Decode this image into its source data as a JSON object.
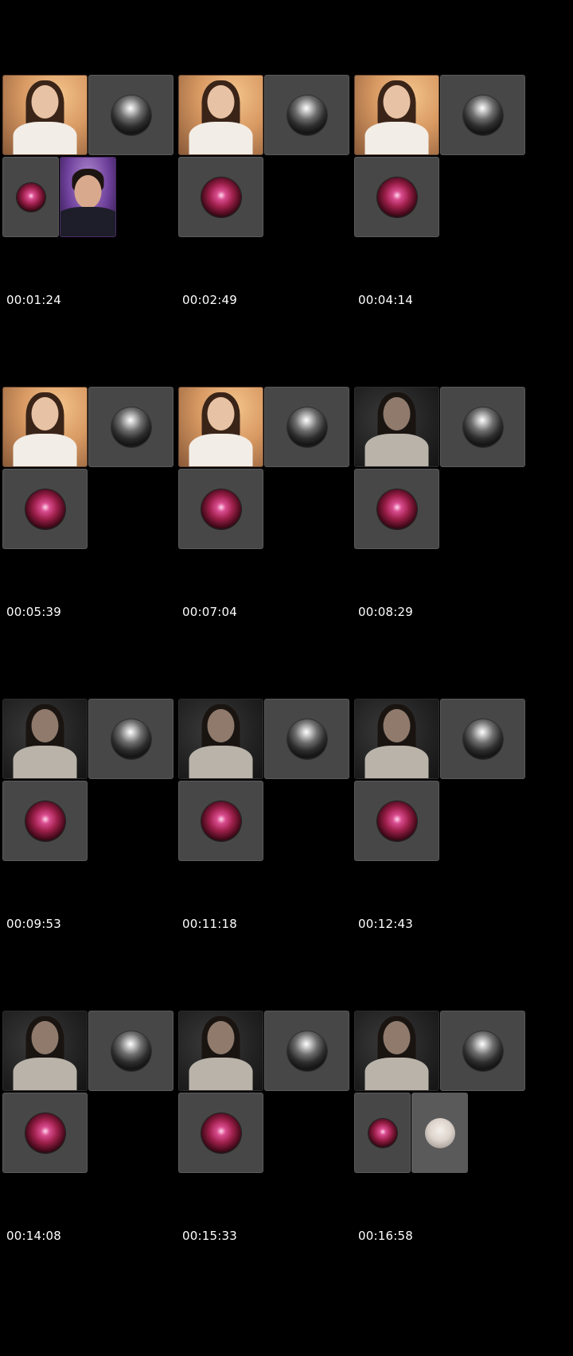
{
  "grid": {
    "frames": [
      {
        "timestamp": "00:01:24",
        "participants": [
          "video-warm",
          "avatar-moon",
          "avatar-stage",
          "video-purple"
        ]
      },
      {
        "timestamp": "00:02:49",
        "participants": [
          "video-warm",
          "avatar-moon",
          "avatar-stage"
        ]
      },
      {
        "timestamp": "00:04:14",
        "participants": [
          "video-warm",
          "avatar-moon",
          "avatar-stage"
        ]
      },
      {
        "timestamp": "00:05:39",
        "participants": [
          "video-warm",
          "avatar-moon",
          "avatar-stage"
        ]
      },
      {
        "timestamp": "00:07:04",
        "participants": [
          "video-warm",
          "avatar-moon",
          "avatar-stage"
        ]
      },
      {
        "timestamp": "00:08:29",
        "participants": [
          "video-dark",
          "avatar-moon",
          "avatar-stage"
        ]
      },
      {
        "timestamp": "00:09:53",
        "participants": [
          "video-dark",
          "avatar-moon",
          "avatar-stage"
        ]
      },
      {
        "timestamp": "00:11:18",
        "participants": [
          "video-dark",
          "avatar-moon",
          "avatar-stage"
        ]
      },
      {
        "timestamp": "00:12:43",
        "participants": [
          "video-dark",
          "avatar-moon",
          "avatar-stage"
        ]
      },
      {
        "timestamp": "00:14:08",
        "participants": [
          "video-dark",
          "avatar-moon",
          "avatar-stage"
        ]
      },
      {
        "timestamp": "00:15:33",
        "participants": [
          "video-dark",
          "avatar-moon",
          "avatar-stage"
        ]
      },
      {
        "timestamp": "00:16:58",
        "participants": [
          "video-dark",
          "avatar-moon",
          "avatar-stage",
          "avatar-face"
        ]
      }
    ]
  },
  "colors": {
    "background": "#000000",
    "tile_gray": "#474747",
    "timestamp_text": "#ffffff"
  }
}
